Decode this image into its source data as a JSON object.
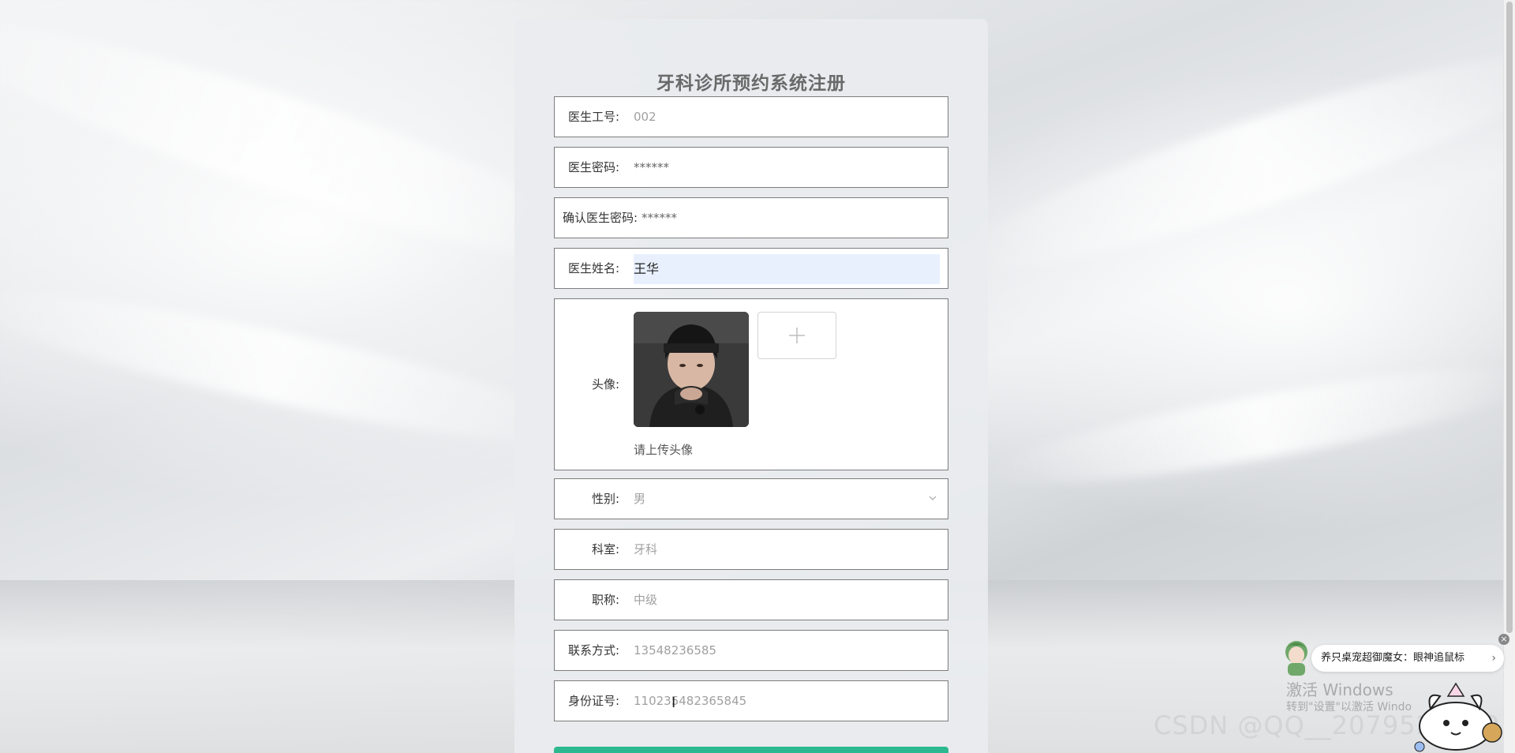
{
  "page": {
    "title": "牙科诊所预约系统注册"
  },
  "form": {
    "doctor_id": {
      "label": "医生工号:",
      "value": "002"
    },
    "password": {
      "label": "医生密码:",
      "value": "******"
    },
    "confirm_password": {
      "label": "确认医生密码:",
      "value": "******"
    },
    "name": {
      "label": "医生姓名:",
      "value": "王华"
    },
    "avatar": {
      "label": "头像:",
      "hint": "请上传头像",
      "add_icon": "plus-icon"
    },
    "gender": {
      "label": "性别:",
      "value": "男",
      "icon": "chevron-down-icon"
    },
    "department": {
      "label": "科室:",
      "value": "牙科"
    },
    "title_rank": {
      "label": "职称:",
      "value": "中级"
    },
    "phone": {
      "label": "联系方式:",
      "value": "13548236585"
    },
    "id_card": {
      "label": "身份证号:",
      "value": "110235482365845"
    }
  },
  "overlays": {
    "windows_activation_line1": "激活 Windows",
    "windows_activation_line2": "转到\"设置\"以激活 Windo",
    "csdn_watermark": "CSDN @QQ__2079523559",
    "toast_text": "养只桌宠超御魔女：眼神追鼠标",
    "toast_chevron": "›",
    "toast_close": "×"
  },
  "colors": {
    "submit_accent": "#2db88f",
    "autofill_bg": "#e8f0fe"
  }
}
